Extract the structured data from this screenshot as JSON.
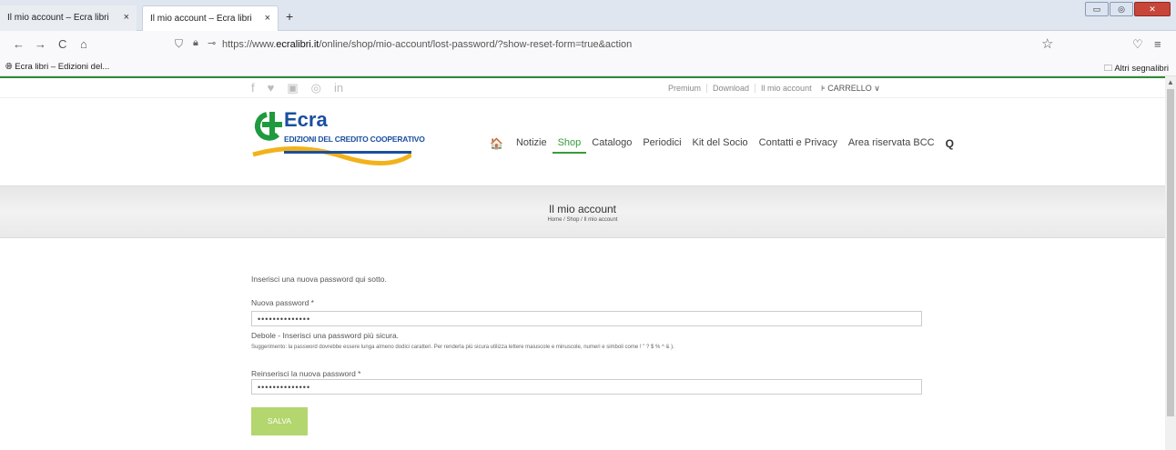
{
  "browser": {
    "tabs": [
      {
        "label": "Il mio account – Ecra libri",
        "close": "×"
      },
      {
        "label": "Il mio account – Ecra libri",
        "close": "×"
      }
    ],
    "new_tab": "+",
    "window_buttons": {
      "minimize": "▭",
      "maximize": "◎",
      "close": "✕"
    },
    "nav": {
      "back": "←",
      "forward": "→",
      "reload": "C",
      "home": "⌂"
    },
    "url_prefix": "https://www.",
    "url_domain": "ecralibri.it",
    "url_path": "/online/shop/mio-account/lost-password/?show-reset-form=true&action",
    "star": "☆",
    "pocket": "♡",
    "menu": "≡",
    "bookmarks": {
      "left": "Ecra libri – Edizioni del...",
      "right": "Altri segnalibri"
    }
  },
  "site": {
    "social_icons": [
      "f",
      "♥",
      "▣",
      "◎",
      "in"
    ],
    "top_links": [
      "Premium",
      "Download",
      "Il mio account"
    ],
    "cart": "CARRELLO",
    "cart_icon": "⊧",
    "logo": {
      "word": "Ecra",
      "sub": "EDIZIONI DEL CREDITO COOPERATIVO"
    },
    "menu": {
      "home_icon": "🏠",
      "items": [
        "Notizie",
        "Shop",
        "Catalogo",
        "Periodici",
        "Kit del Socio",
        "Contatti e Privacy",
        "Area riservata BCC"
      ],
      "active": "Shop",
      "search_icon": "Q"
    },
    "page_title": "Il mio account",
    "breadcrumb": "Home / Shop / Il mio account"
  },
  "form": {
    "intro": "Inserisci una nuova password qui sotto.",
    "new_password_label": "Nuova password *",
    "new_password_value": "••••••••••••••",
    "strength": "Debole - Inserisci una password più sicura.",
    "hint": "Suggerimento: la password dovrebbe essere lunga almeno dodici caratteri. Per renderla più sicura utilizza lettere maiuscole e minuscole, numeri e simboli come ! \" ? $ % ^ & ).",
    "repeat_label": "Reinserisci la nuova password *",
    "repeat_value": "••••••••••••••",
    "save": "SALVA"
  }
}
